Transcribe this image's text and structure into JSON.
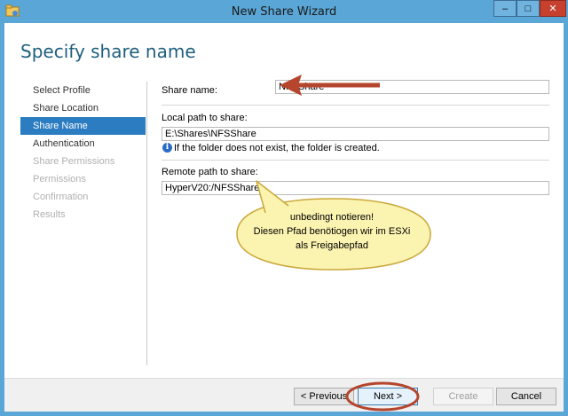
{
  "window": {
    "title": "New Share Wizard",
    "minimize_glyph": "–",
    "maximize_glyph": "□",
    "close_glyph": "✕"
  },
  "page": {
    "heading": "Specify share name"
  },
  "nav": {
    "items": [
      {
        "label": "Select Profile",
        "state": "normal"
      },
      {
        "label": "Share Location",
        "state": "normal"
      },
      {
        "label": "Share Name",
        "state": "active"
      },
      {
        "label": "Authentication",
        "state": "normal"
      },
      {
        "label": "Share Permissions",
        "state": "disabled"
      },
      {
        "label": "Permissions",
        "state": "disabled"
      },
      {
        "label": "Confirmation",
        "state": "disabled"
      },
      {
        "label": "Results",
        "state": "disabled"
      }
    ]
  },
  "form": {
    "share_name_label": "Share name:",
    "share_name_value": "NFSShare",
    "local_path_label": "Local path to share:",
    "local_path_value": "E:\\Shares\\NFSShare",
    "info_text": "If the folder does not exist, the folder is created.",
    "remote_path_label": "Remote path to share:",
    "remote_path_value": "HyperV20:/NFSShare"
  },
  "callout": {
    "lines": [
      "unbedingt notieren!",
      "Diesen Pfad benötiogen wir im ESXi",
      "als Freigabepfad"
    ]
  },
  "footer": {
    "previous_label": "< Previous",
    "next_label": "Next >",
    "create_label": "Create",
    "cancel_label": "Cancel"
  },
  "colors": {
    "titlebar": "#5aa6d6",
    "heading": "#1e5f7e",
    "nav_active": "#2b7cc1",
    "annotation_arrow": "#b5452d",
    "callout_fill": "#fbf3b0"
  }
}
